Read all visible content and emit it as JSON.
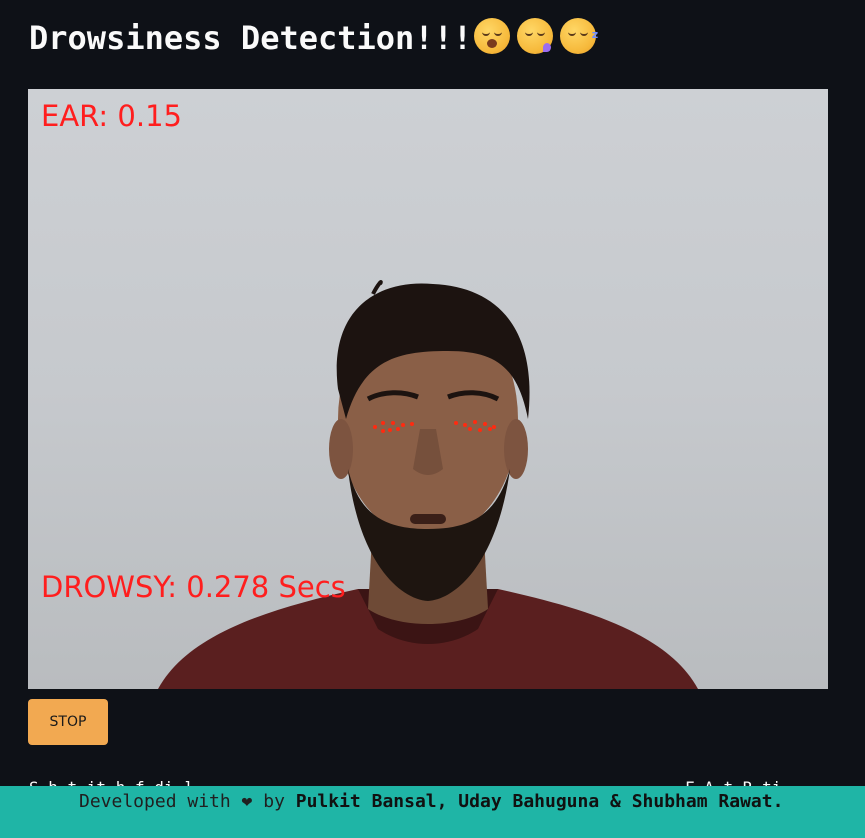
{
  "header": {
    "title": "Drowsiness Detection!!!",
    "emojis": [
      "yawning-face-icon",
      "sleepy-face-icon",
      "sleeping-face-icon"
    ]
  },
  "video": {
    "ear_label": "EAR: 0.15",
    "drowsy_label": "DROWSY: 0.278 Secs",
    "overlay_color": "#ff1e1e"
  },
  "controls": {
    "stop_label": "STOP"
  },
  "below": {
    "left_text": "S      h t      it h f           di   ]",
    "right_text": "F  A    t R ti"
  },
  "footer": {
    "prefix": "Developed with ❤ by ",
    "authors": "Pulkit Bansal, Uday Bahuguna & Shubham Rawat.",
    "background": "#1fb5a6"
  },
  "colors": {
    "page_bg": "#0e1117",
    "button_bg": "#f2a951"
  }
}
